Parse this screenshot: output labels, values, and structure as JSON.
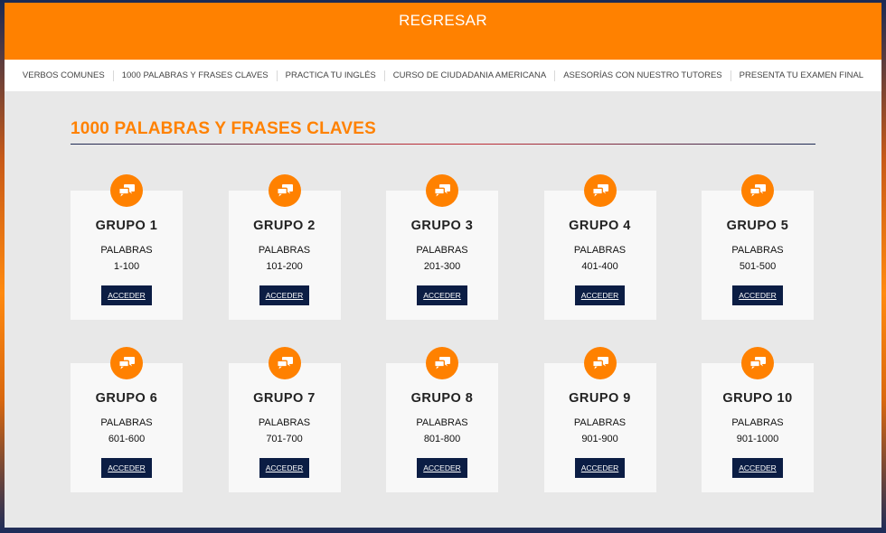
{
  "header": {
    "back_label": "REGRESAR"
  },
  "nav": {
    "items": [
      "VERBOS COMUNES",
      "1000 PALABRAS Y FRASES CLAVES",
      "PRACTICA TU INGLÉS",
      "CURSO DE CIUDADANIA AMERICANA",
      "ASESORÍAS CON NUESTRO TUTORES",
      "PRESENTA TU EXAMEN FINAL"
    ]
  },
  "main": {
    "title": "1000 PALABRAS Y FRASES CLAVES"
  },
  "colors": {
    "accent": "#ff8100",
    "button": "#0b1d44",
    "card": "#f8f8f8",
    "background": "#e8e8e8"
  },
  "cards": [
    {
      "title": "GRUPO 1",
      "label": "PALABRAS",
      "range": "1-100",
      "button": "ACCEDER",
      "icon": "chat-bubbles-icon"
    },
    {
      "title": "GRUPO 2",
      "label": "PALABRAS",
      "range": "101-200",
      "button": "ACCEDER",
      "icon": "chat-bubbles-icon"
    },
    {
      "title": "GRUPO 3",
      "label": "PALABRAS",
      "range": "201-300",
      "button": "ACCEDER",
      "icon": "chat-bubbles-icon"
    },
    {
      "title": "GRUPO 4",
      "label": "PALABRAS",
      "range": "401-400",
      "button": "ACCEDER",
      "icon": "chat-bubbles-icon"
    },
    {
      "title": "GRUPO 5",
      "label": "PALABRAS",
      "range": "501-500",
      "button": "ACCEDER",
      "icon": "chat-bubbles-icon"
    },
    {
      "title": "GRUPO 6",
      "label": "PALABRAS",
      "range": "601-600",
      "button": "ACCEDER",
      "icon": "chat-bubbles-icon"
    },
    {
      "title": "GRUPO 7",
      "label": "PALABRAS",
      "range": "701-700",
      "button": "ACCEDER",
      "icon": "chat-bubbles-icon"
    },
    {
      "title": "GRUPO 8",
      "label": "PALABRAS",
      "range": "801-800",
      "button": "ACCEDER",
      "icon": "chat-bubbles-icon"
    },
    {
      "title": "GRUPO 9",
      "label": "PALABRAS",
      "range": "901-900",
      "button": "ACCEDER",
      "icon": "chat-bubbles-icon"
    },
    {
      "title": "GRUPO 10",
      "label": "PALABRAS",
      "range": "901-1000",
      "button": "ACCEDER",
      "icon": "chat-bubbles-icon"
    }
  ]
}
